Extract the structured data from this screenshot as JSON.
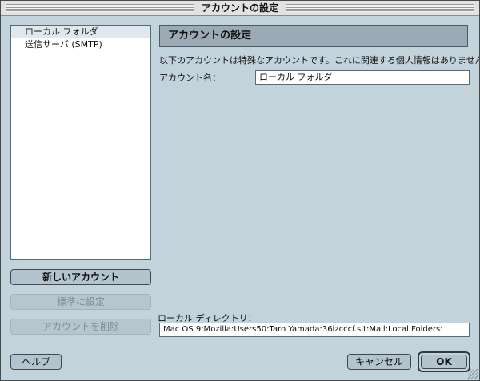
{
  "window": {
    "title": "アカウントの設定"
  },
  "sidebar": {
    "items": [
      {
        "label": "ローカル フォルダ"
      },
      {
        "label": "送信サーバ (SMTP)"
      }
    ]
  },
  "buttons": {
    "new_account": "新しいアカウント",
    "set_default": "標準に設定",
    "delete_account": "アカウントを削除",
    "help": "ヘルプ",
    "cancel": "キャンセル",
    "ok": "OK"
  },
  "panel": {
    "header": "アカウントの設定",
    "description": "以下のアカウントは特殊なアカウントです。これに関連する個人情報はありません。",
    "account_name_label": "アカウント名：",
    "account_name_value": "ローカル フォルダ",
    "local_dir_label": "ローカル ディレクトリ：",
    "local_dir_value": "Mac OS 9:Mozilla:Users50:Taro Yamada:36izcccf.slt:Mail:Local Folders:"
  }
}
